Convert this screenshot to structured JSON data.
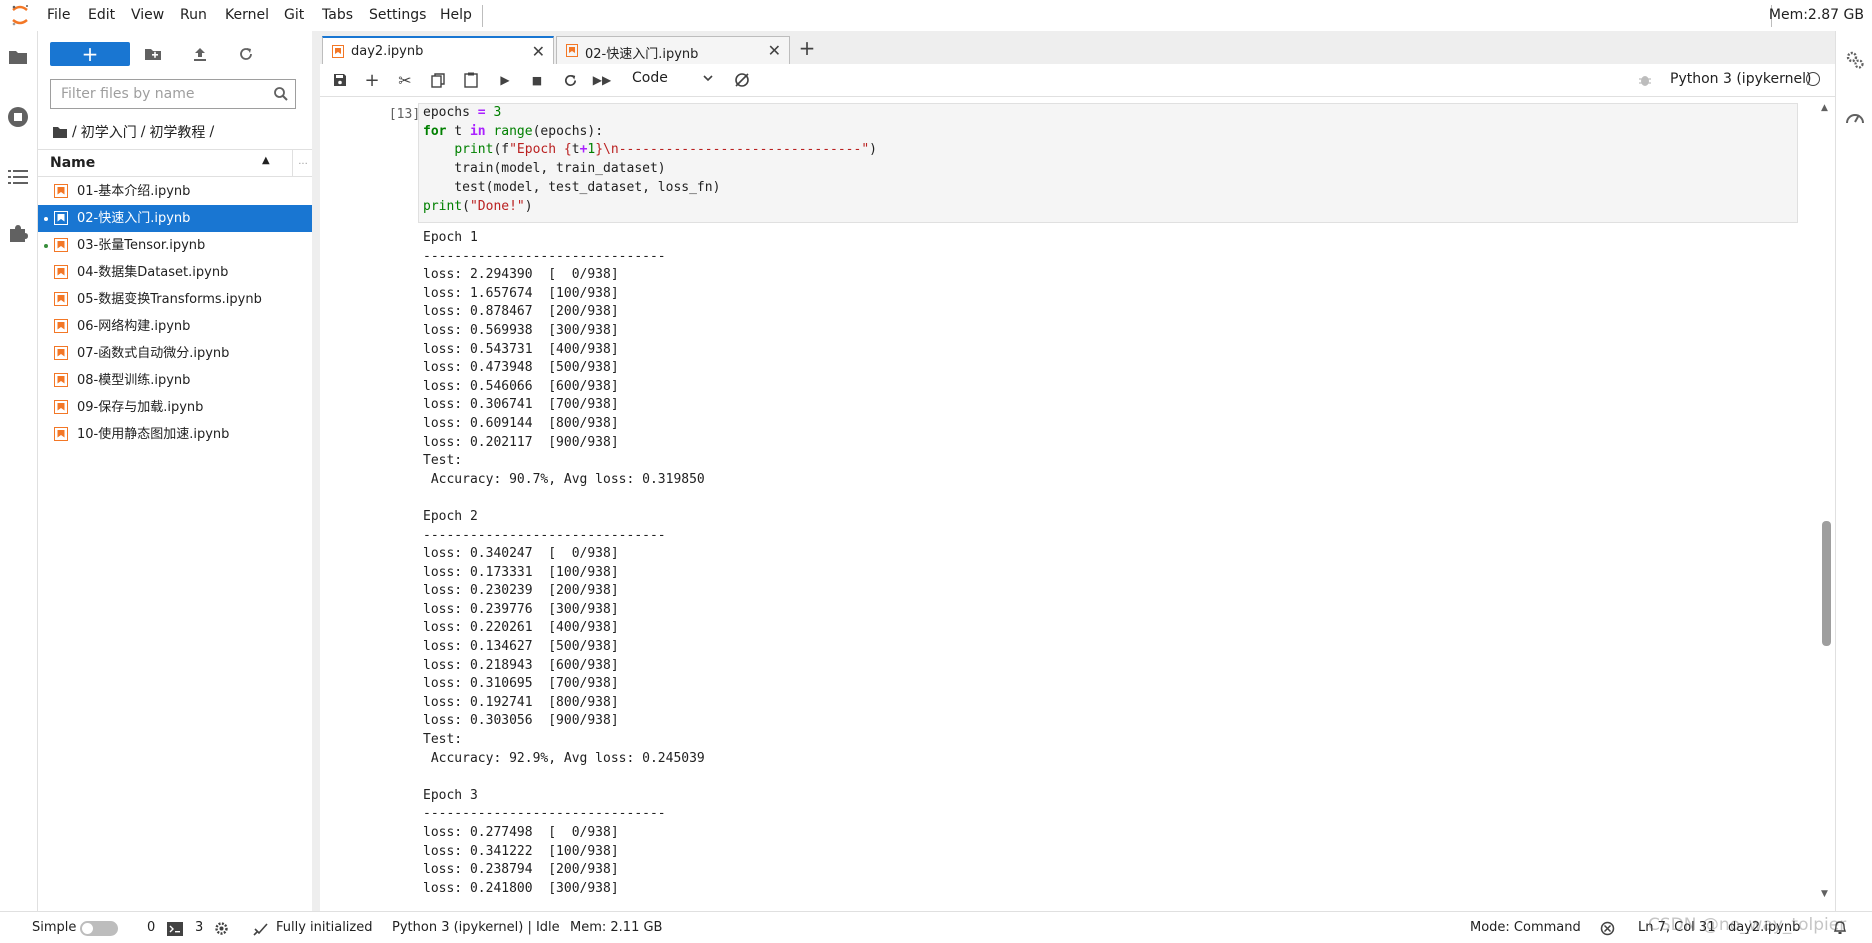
{
  "menubar": {
    "items": [
      "File",
      "Edit",
      "View",
      "Run",
      "Kernel",
      "Git",
      "Tabs",
      "Settings",
      "Help"
    ],
    "memory": "Mem:2.87 GB"
  },
  "filebrowser": {
    "new_label": "+",
    "filter_placeholder": "Filter files by name",
    "breadcrumb": [
      "初学入门",
      "初学教程"
    ],
    "column_name": "Name",
    "files": [
      {
        "name": "01-基本介绍.ipynb",
        "running": false,
        "selected": false
      },
      {
        "name": "02-快速入门.ipynb",
        "running": true,
        "selected": true
      },
      {
        "name": "03-张量Tensor.ipynb",
        "running": true,
        "selected": false
      },
      {
        "name": "04-数据集Dataset.ipynb",
        "running": false,
        "selected": false
      },
      {
        "name": "05-数据变换Transforms.ipynb",
        "running": false,
        "selected": false
      },
      {
        "name": "06-网络构建.ipynb",
        "running": false,
        "selected": false
      },
      {
        "name": "07-函数式自动微分.ipynb",
        "running": false,
        "selected": false
      },
      {
        "name": "08-模型训练.ipynb",
        "running": false,
        "selected": false
      },
      {
        "name": "09-保存与加载.ipynb",
        "running": false,
        "selected": false
      },
      {
        "name": "10-使用静态图加速.ipynb",
        "running": false,
        "selected": false
      }
    ]
  },
  "tabs": [
    {
      "label": "day2.ipynb",
      "active": true
    },
    {
      "label": "02-快速入门.ipynb",
      "active": false
    }
  ],
  "toolbar": {
    "cell_type": "Code",
    "kernel": "Python 3 (ipykernel)"
  },
  "cell": {
    "prompt": "[13]:",
    "code": "epochs = 3\nfor t in range(epochs):\n    print(f\"Epoch {t+1}\\n-------------------------------\")\n    train(model, train_dataset)\n    test(model, test_dataset, loss_fn)\nprint(\"Done!\")",
    "output": "Epoch 1\n-------------------------------\nloss: 2.294390  [  0/938]\nloss: 1.657674  [100/938]\nloss: 0.878467  [200/938]\nloss: 0.569938  [300/938]\nloss: 0.543731  [400/938]\nloss: 0.473948  [500/938]\nloss: 0.546066  [600/938]\nloss: 0.306741  [700/938]\nloss: 0.609144  [800/938]\nloss: 0.202117  [900/938]\nTest: \n Accuracy: 90.7%, Avg loss: 0.319850 \n\nEpoch 2\n-------------------------------\nloss: 0.340247  [  0/938]\nloss: 0.173331  [100/938]\nloss: 0.230239  [200/938]\nloss: 0.239776  [300/938]\nloss: 0.220261  [400/938]\nloss: 0.134627  [500/938]\nloss: 0.218943  [600/938]\nloss: 0.310695  [700/938]\nloss: 0.192741  [800/938]\nloss: 0.303056  [900/938]\nTest: \n Accuracy: 92.9%, Avg loss: 0.245039 \n\nEpoch 3\n-------------------------------\nloss: 0.277498  [  0/938]\nloss: 0.341222  [100/938]\nloss: 0.238794  [200/938]\nloss: 0.241800  [300/938]"
  },
  "statusbar": {
    "simple_label": "Simple",
    "terminals": "0",
    "kernels": "3",
    "initialized": "Fully initialized",
    "kernel_status": "Python 3 (ipykernel) | Idle",
    "memory": "Mem: 2.11 GB",
    "mode": "Mode: Command",
    "position": "Ln 7, Col 31",
    "filename": "day2.ipynb",
    "watermark": "CSDN @no_way_tolpier"
  },
  "colors": {
    "accent": "#1976d2",
    "notebook_icon": "#f37726"
  }
}
